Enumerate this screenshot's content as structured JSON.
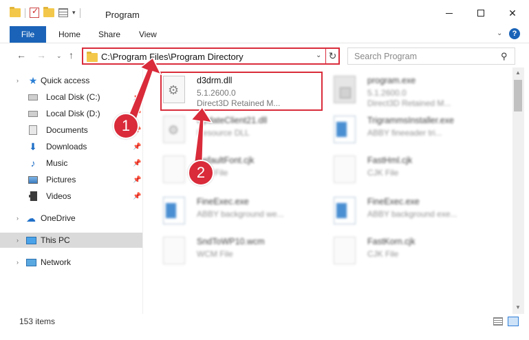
{
  "window": {
    "title": "Program",
    "minimize": "—",
    "maximize": "☐",
    "close": "✕"
  },
  "ribbon": {
    "file": "File",
    "tabs": [
      "Home",
      "Share",
      "View"
    ]
  },
  "address": {
    "path": "C:\\Program Files\\Program Directory"
  },
  "search": {
    "placeholder": "Search Program"
  },
  "sidebar": {
    "items": [
      {
        "label": "Quick access",
        "icon": "star-icon",
        "pinned": false
      },
      {
        "label": "Local Disk (C:)",
        "icon": "disk-icon",
        "pinned": true
      },
      {
        "label": "Local Disk (D:)",
        "icon": "disk-icon",
        "pinned": true
      },
      {
        "label": "Documents",
        "icon": "documents-icon",
        "pinned": true
      },
      {
        "label": "Downloads",
        "icon": "download-icon",
        "pinned": true
      },
      {
        "label": "Music",
        "icon": "music-icon",
        "pinned": true
      },
      {
        "label": "Pictures",
        "icon": "pictures-icon",
        "pinned": true
      },
      {
        "label": "Videos",
        "icon": "videos-icon",
        "pinned": true
      },
      {
        "label": "OneDrive",
        "icon": "cloud-icon",
        "pinned": false
      },
      {
        "label": "This PC",
        "icon": "pc-icon",
        "pinned": false
      },
      {
        "label": "Network",
        "icon": "network-icon",
        "pinned": false
      }
    ]
  },
  "files": [
    {
      "name": "d3drm.dll",
      "line1": "5.1.2600.0",
      "line2": "Direct3D Retained M...",
      "icon": "dll-icon",
      "highlighted": true
    },
    {
      "name": "program.exe",
      "line1": "5.1.2600.0",
      "line2": "Direct3D Retained M...",
      "icon": "exe-icon"
    },
    {
      "name": "UpdateClient21.dll",
      "line1": "Resource DLL",
      "line2": "",
      "icon": "dll-icon"
    },
    {
      "name": "TrigrammsInstaller.exe",
      "line1": "ABBY fineeader tri...",
      "line2": "",
      "icon": "exe-icon"
    },
    {
      "name": "DefaultFont.cjk",
      "line1": "CJK File",
      "line2": "",
      "icon": "page-icon"
    },
    {
      "name": "FastHml.cjk",
      "line1": "CJK File",
      "line2": "",
      "icon": "page-icon"
    },
    {
      "name": "FineExec.exe",
      "line1": "ABBY background we...",
      "line2": "",
      "icon": "exe-icon"
    },
    {
      "name": "FineExec.exe",
      "line1": "ABBY background exe...",
      "line2": "",
      "icon": "exe-icon"
    },
    {
      "name": "SndToWP10.wcm",
      "line1": "WCM File",
      "line2": "",
      "icon": "page-icon"
    },
    {
      "name": "FastKorn.cjk",
      "line1": "CJK File",
      "line2": "",
      "icon": "page-icon"
    }
  ],
  "status": {
    "items": "153 items"
  },
  "callouts": [
    "1",
    "2"
  ],
  "colors": {
    "accent": "#1a63b8",
    "highlight": "#d92b3a"
  }
}
